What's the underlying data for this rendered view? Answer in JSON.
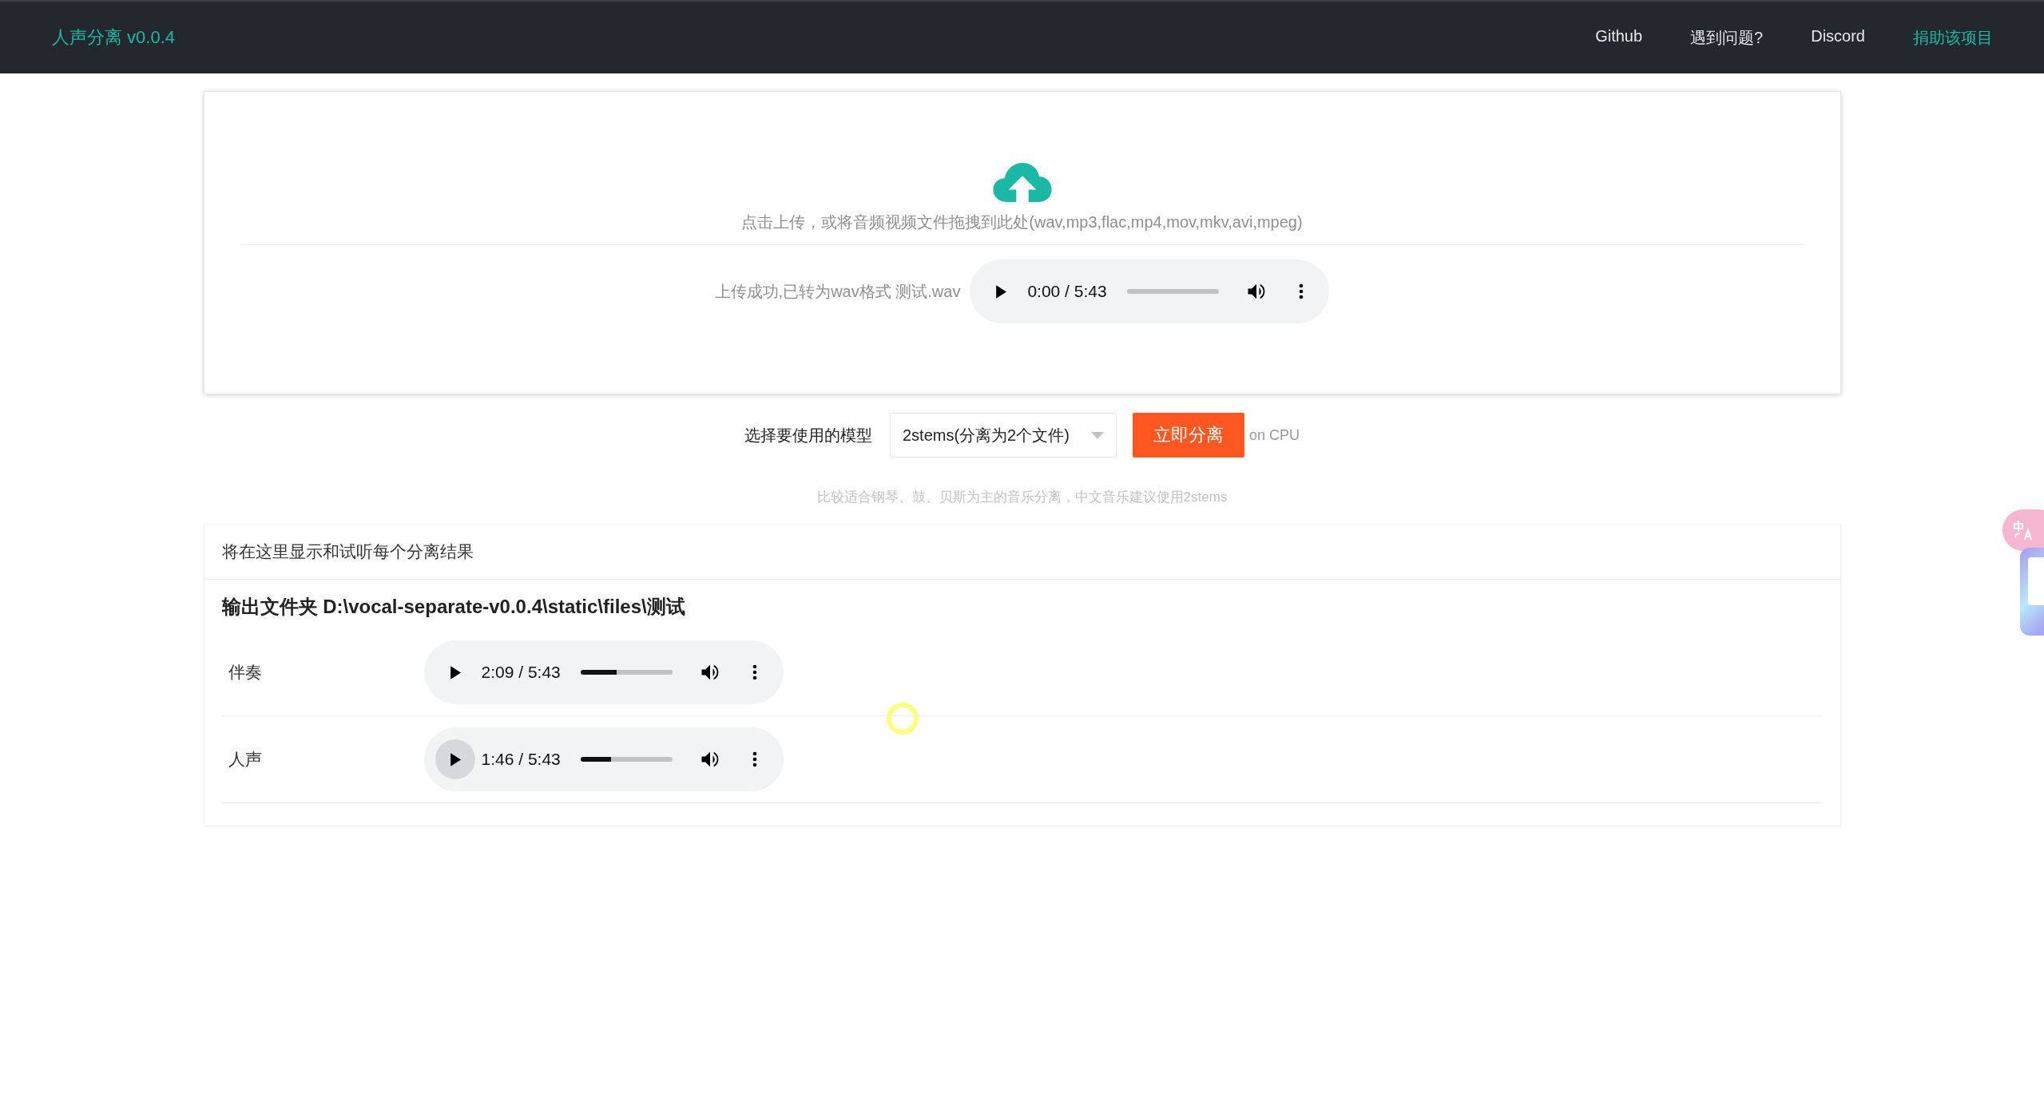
{
  "navbar": {
    "brand": "人声分离 v0.0.4",
    "links": [
      {
        "label": "Github",
        "highlight": false
      },
      {
        "label": "遇到问题?",
        "highlight": false
      },
      {
        "label": "Discord",
        "highlight": false
      },
      {
        "label": "捐助该项目",
        "highlight": true
      }
    ]
  },
  "upload": {
    "hint": "点击上传，或将音频视频文件拖拽到此处(wav,mp3,flac,mp4,mov,mkv,avi,mpeg)",
    "status": "上传成功,已转为wav格式 测试.wav",
    "player": {
      "time": "0:00 / 5:43",
      "level": 0,
      "hovered": false
    }
  },
  "model": {
    "label": "选择要使用的模型",
    "value": "2stems(分离为2个文件)",
    "button": "立即分离",
    "device": "on CPU",
    "note": "比较适合钢琴、鼓、贝斯为主的音乐分离，中文音乐建议使用2stems"
  },
  "results": {
    "intro": "将在这里显示和试听每个分离结果",
    "output_folder": "输出文件夹 D:\\vocal-separate-v0.0.4\\static\\files\\测试",
    "tracks": [
      {
        "name": "伴奏",
        "player": {
          "time": "2:09 / 5:43",
          "level": 0.39,
          "hovered": false
        }
      },
      {
        "name": "人声",
        "player": {
          "time": "1:46 / 5:43",
          "level": 0.33,
          "hovered": true
        }
      }
    ]
  }
}
